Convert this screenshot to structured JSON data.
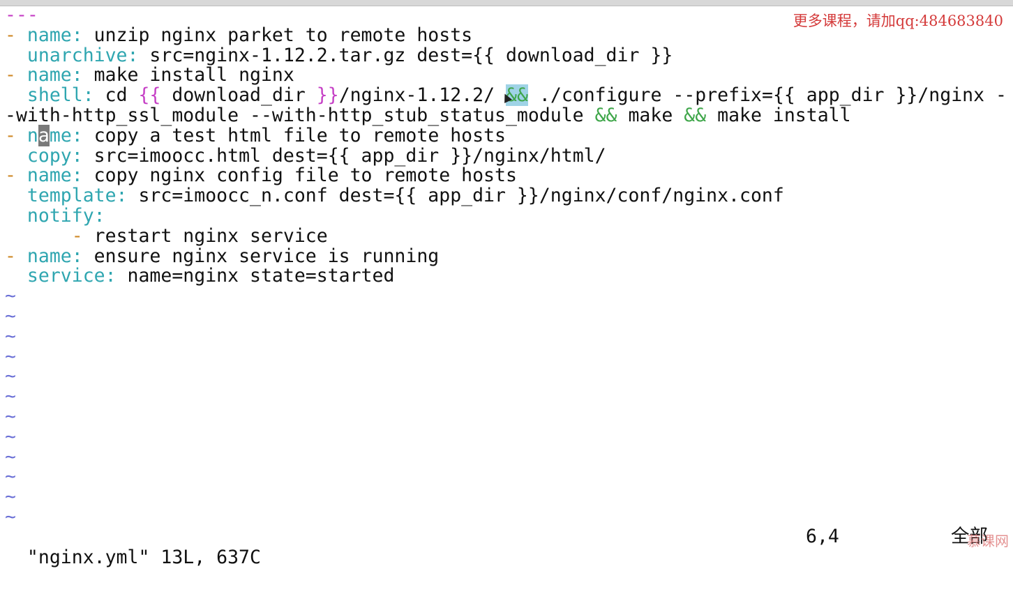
{
  "editor": {
    "lines": [
      [
        {
          "t": "---",
          "c": "sep"
        }
      ],
      [
        {
          "t": "- ",
          "c": "d"
        },
        {
          "t": "name:",
          "c": "k"
        },
        {
          "t": " unzip nginx parket to remote hosts",
          "c": ""
        }
      ],
      [
        {
          "t": "  ",
          "c": ""
        },
        {
          "t": "unarchive:",
          "c": "k"
        },
        {
          "t": " src=nginx-1.12.2.tar.gz dest={{ download_dir }}",
          "c": ""
        }
      ],
      [
        {
          "t": "- ",
          "c": "d"
        },
        {
          "t": "name:",
          "c": "k"
        },
        {
          "t": " make install nginx",
          "c": ""
        }
      ],
      [
        {
          "t": "  ",
          "c": ""
        },
        {
          "t": "shell:",
          "c": "k"
        },
        {
          "t": " cd ",
          "c": ""
        },
        {
          "t": "{{",
          "c": "b"
        },
        {
          "t": " download_dir ",
          "c": ""
        },
        {
          "t": "}}",
          "c": "b"
        },
        {
          "t": "/nginx-1.12.2/ ",
          "c": ""
        },
        {
          "t": "&&",
          "c": "a hl"
        },
        {
          "t": " ./configure --prefix={{ app_dir }}/nginx -",
          "c": ""
        }
      ],
      [
        {
          "t": "-with-http_ssl_module --with-http_stub_status_module ",
          "c": ""
        },
        {
          "t": "&&",
          "c": "a"
        },
        {
          "t": " make ",
          "c": ""
        },
        {
          "t": "&&",
          "c": "a"
        },
        {
          "t": " make install",
          "c": ""
        }
      ],
      [
        {
          "t": "- ",
          "c": "d"
        },
        {
          "t": "n",
          "c": "k"
        },
        {
          "t": "a",
          "c": "cur"
        },
        {
          "t": "me:",
          "c": "k"
        },
        {
          "t": " copy a test html file to remote hosts",
          "c": ""
        }
      ],
      [
        {
          "t": "  ",
          "c": ""
        },
        {
          "t": "copy:",
          "c": "k"
        },
        {
          "t": " src=imoocc.html dest={{ app_dir }}/nginx/html/",
          "c": ""
        }
      ],
      [
        {
          "t": "- ",
          "c": "d"
        },
        {
          "t": "name:",
          "c": "k"
        },
        {
          "t": " copy nginx config file to remote hosts",
          "c": ""
        }
      ],
      [
        {
          "t": "  ",
          "c": ""
        },
        {
          "t": "template:",
          "c": "k"
        },
        {
          "t": " src=imoocc_n.conf dest={{ app_dir }}/nginx/conf/nginx.conf",
          "c": ""
        }
      ],
      [
        {
          "t": "  ",
          "c": ""
        },
        {
          "t": "notify:",
          "c": "k"
        }
      ],
      [
        {
          "t": "      ",
          "c": ""
        },
        {
          "t": "- ",
          "c": "d"
        },
        {
          "t": "restart nginx service",
          "c": ""
        }
      ],
      [
        {
          "t": "- ",
          "c": "d"
        },
        {
          "t": "name:",
          "c": "k"
        },
        {
          "t": " ensure nginx service is running",
          "c": ""
        }
      ],
      [
        {
          "t": "  ",
          "c": ""
        },
        {
          "t": "service:",
          "c": "k"
        },
        {
          "t": " name=nginx state=started",
          "c": ""
        }
      ],
      [
        {
          "t": "~",
          "c": "tilde"
        }
      ],
      [
        {
          "t": "~",
          "c": "tilde"
        }
      ],
      [
        {
          "t": "~",
          "c": "tilde"
        }
      ],
      [
        {
          "t": "~",
          "c": "tilde"
        }
      ],
      [
        {
          "t": "~",
          "c": "tilde"
        }
      ],
      [
        {
          "t": "~",
          "c": "tilde"
        }
      ],
      [
        {
          "t": "~",
          "c": "tilde"
        }
      ],
      [
        {
          "t": "~",
          "c": "tilde"
        }
      ],
      [
        {
          "t": "~",
          "c": "tilde"
        }
      ],
      [
        {
          "t": "~",
          "c": "tilde"
        }
      ],
      [
        {
          "t": "~",
          "c": "tilde"
        }
      ],
      [
        {
          "t": "~",
          "c": "tilde"
        }
      ]
    ]
  },
  "status": {
    "file_info": "\"nginx.yml\" 13L, 637C",
    "cursor_pos": "6,4",
    "scroll_pct": "全部"
  },
  "watermark": {
    "text": "更多课程，请加qq:484683840"
  },
  "logo": {
    "text": "慕课网"
  },
  "colors": {
    "key": "#2fa6b0",
    "dash": "#cf8a2a",
    "brace": "#c53fc5",
    "and_op": "#3fa64a",
    "tilde": "#6a6fd6",
    "search_highlight": "#9fd3e6"
  }
}
